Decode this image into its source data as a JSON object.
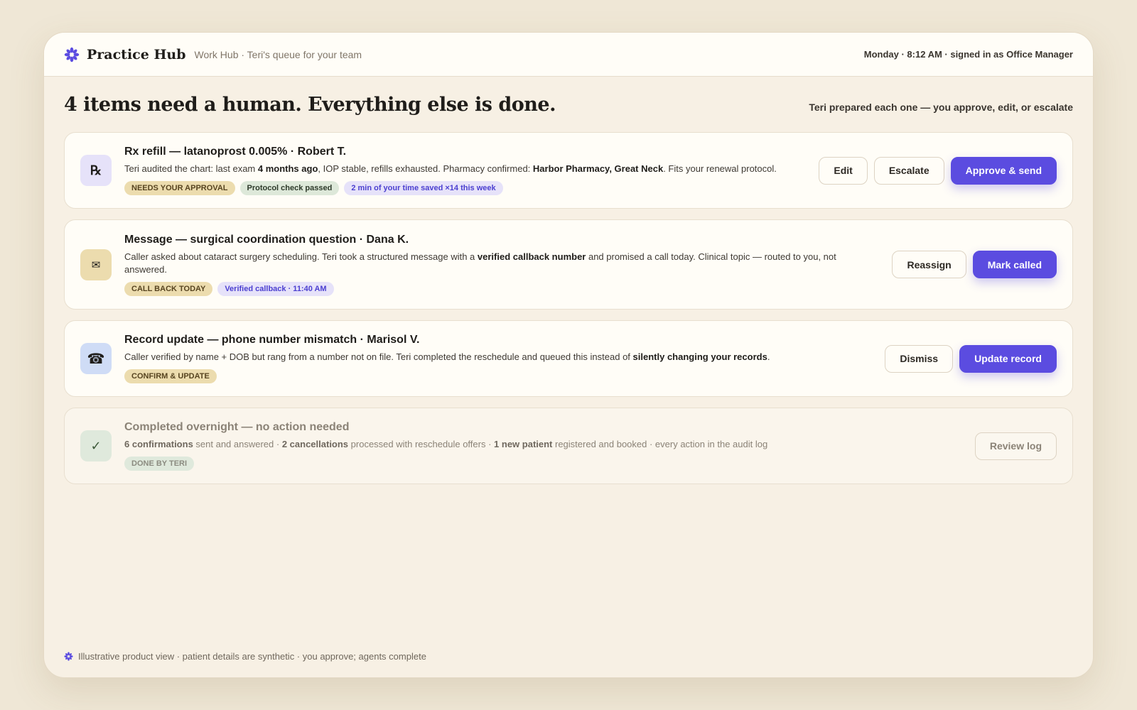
{
  "header": {
    "brand": "Practice Hub",
    "subtitle": "Work Hub · Teri's queue for your team",
    "status": "Monday · 8:12 AM · signed in as Office Manager",
    "accent_color": "#5b4ce0"
  },
  "main": {
    "headline": "4 items need a human. Everything else is done.",
    "note": "Teri prepared each one — you approve, edit, or escalate"
  },
  "cards": [
    {
      "icon": "rx-icon",
      "icon_glyph": "℞",
      "title": "Rx refill — latanoprost 0.005% · Robert T.",
      "desc": {
        "p1": "Teri audited the chart: last exam ",
        "b1": "4 months ago",
        "p2": ", IOP stable, refills exhausted. Pharmacy confirmed: ",
        "b2": "Harbor Pharmacy, Great Neck",
        "p3": ". Fits your renewal protocol."
      },
      "tags": [
        "Needs your approval",
        "Protocol check passed",
        "2 min of your time saved ×14 this week"
      ],
      "actions": [
        "Edit",
        "Escalate",
        "Approve & send"
      ]
    },
    {
      "icon": "envelope-icon",
      "icon_glyph": "✉",
      "title": "Message — surgical coordination question · Dana K.",
      "desc": {
        "p1": "Caller asked about cataract surgery scheduling. Teri took a structured message with a ",
        "b1": "verified callback number",
        "p2": " and promised a call today. Clinical topic — routed to you, not answered."
      },
      "tags": [
        "Call back today",
        "Verified callback · 11:40 AM"
      ],
      "actions": [
        "Reassign",
        "Mark called"
      ]
    },
    {
      "icon": "phone-icon",
      "icon_glyph": "☎",
      "title": "Record update — phone number mismatch · Marisol V.",
      "desc": {
        "p1": "Caller verified by name + DOB but rang from a number not on file. Teri completed the reschedule and queued this instead of ",
        "b1": "silently changing your records",
        "p2": "."
      },
      "tags": [
        "Confirm & update"
      ],
      "actions": [
        "Dismiss",
        "Update record"
      ]
    },
    {
      "icon": "checkmark-icon",
      "icon_glyph": "✓",
      "title": "Completed overnight — no action needed",
      "desc": {
        "b1": "6 confirmations",
        "p1": " sent and answered · ",
        "b2": "2 cancellations",
        "p2": " processed with reschedule offers · ",
        "b3": "1 new patient",
        "p3": " registered and booked · every action in the audit log"
      },
      "tags": [
        "Done by Teri"
      ],
      "actions": [
        "Review log"
      ]
    }
  ],
  "footer": {
    "text": "Illustrative product view · patient details are synthetic · you approve; agents complete"
  }
}
